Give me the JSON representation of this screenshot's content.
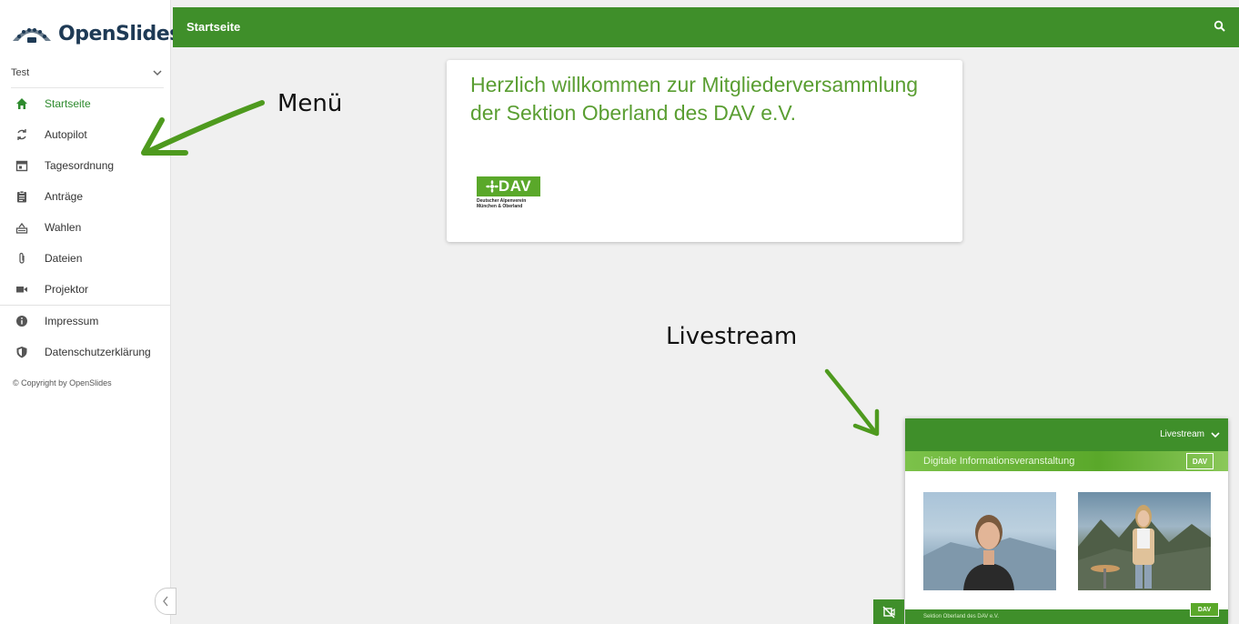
{
  "app": {
    "logo_text": "OpenSlides",
    "meeting_name": "Test",
    "copyright": "© Copyright by OpenSlides"
  },
  "nav": {
    "items": [
      {
        "label": "Startseite",
        "icon": "home-icon",
        "active": true
      },
      {
        "label": "Autopilot",
        "icon": "autopilot-icon"
      },
      {
        "label": "Tagesordnung",
        "icon": "calendar-icon"
      },
      {
        "label": "Anträge",
        "icon": "clipboard-icon"
      },
      {
        "label": "Wahlen",
        "icon": "ballot-icon"
      },
      {
        "label": "Dateien",
        "icon": "paperclip-icon"
      },
      {
        "label": "Projektor",
        "icon": "videocam-icon"
      },
      {
        "label": "Impressum",
        "icon": "info-icon"
      },
      {
        "label": "Datenschutzerklärung",
        "icon": "shield-icon"
      }
    ]
  },
  "header": {
    "title": "Startseite"
  },
  "welcome": {
    "line1": "Herzlich willkommen zur Mitgliederversammlung",
    "line2": "der Sektion Oberland des DAV e.V.",
    "logo_main": "DAV",
    "logo_sub1": "Deutscher Alpenverein",
    "logo_sub2": "München & Oberland"
  },
  "annotations": {
    "menu": "Menü",
    "livestream": "Livestream"
  },
  "livestream": {
    "header_label": "Livestream",
    "banner_text": "Digitale Informationsveranstaltung",
    "footer_text": "Sektion Oberland des DAV e.V.",
    "logo": "DAV"
  },
  "colors": {
    "brand_green": "#3f8f2a",
    "title_green": "#5a9e32",
    "logo_navy": "#1e3a55"
  }
}
